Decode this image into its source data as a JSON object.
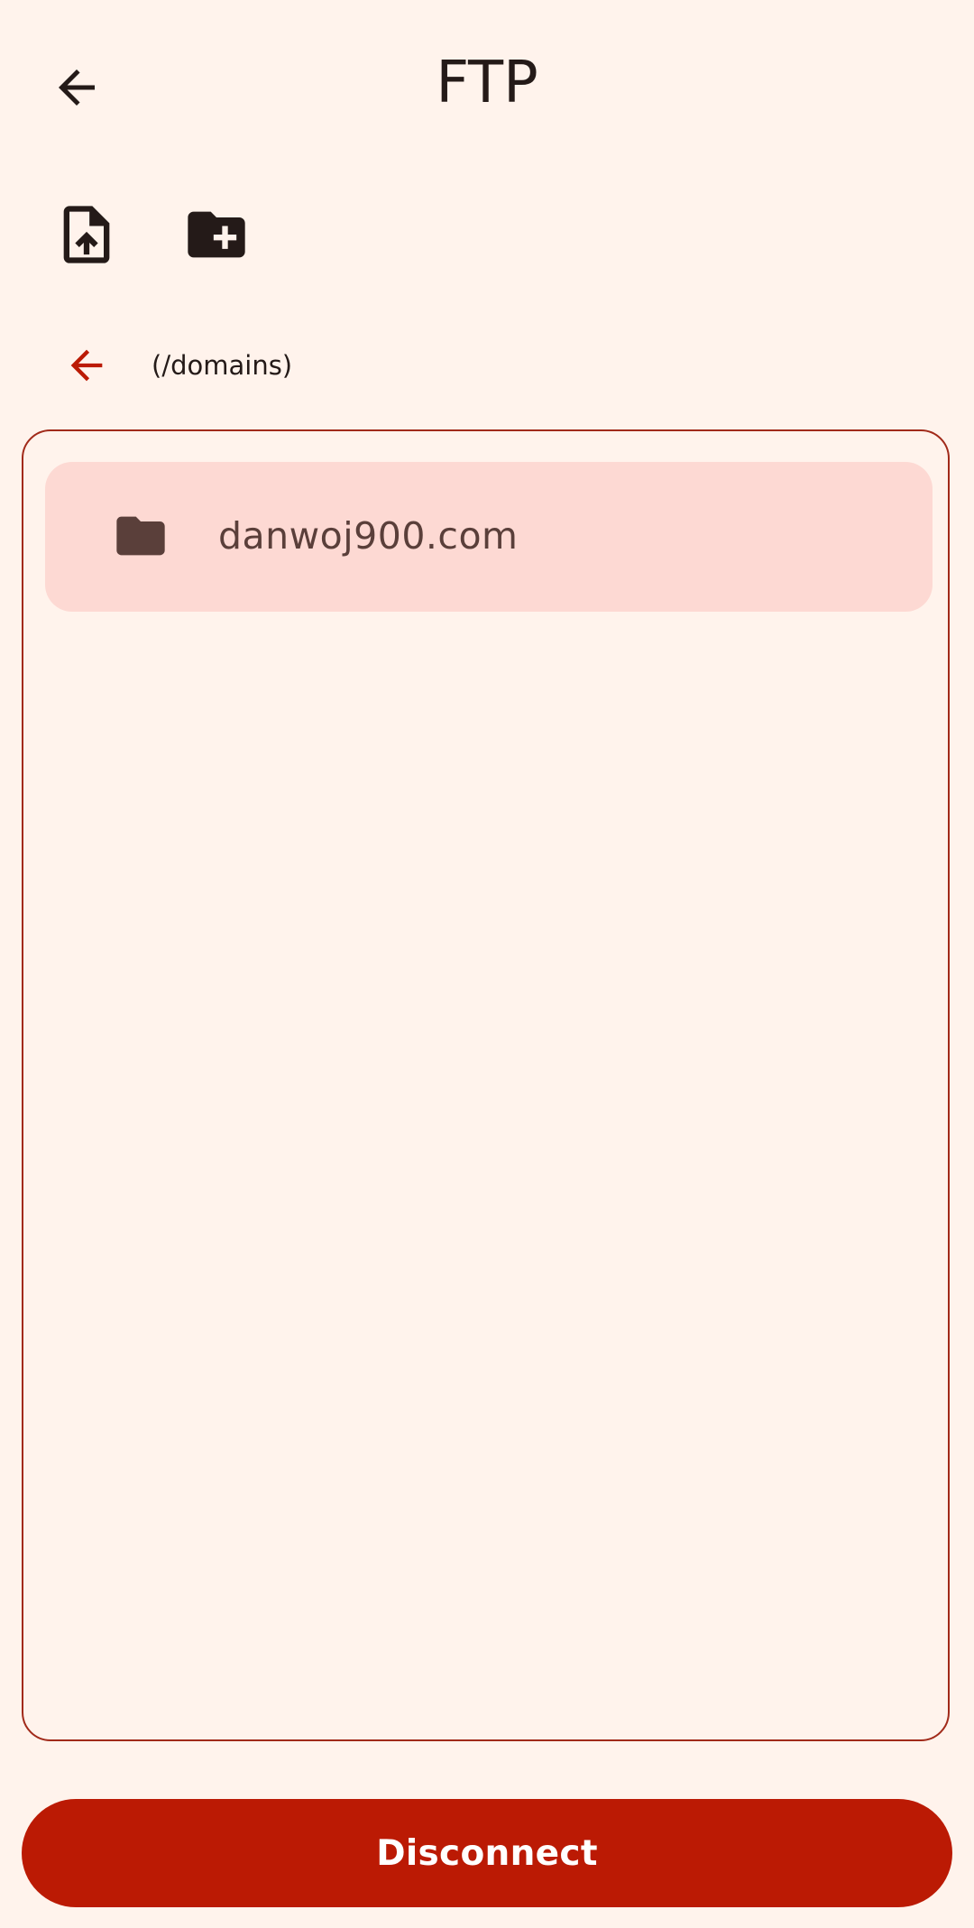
{
  "header": {
    "title": "FTP",
    "back_icon": "arrow-back-icon"
  },
  "toolbar": {
    "upload_icon": "file-upload-icon",
    "new_folder_icon": "create-new-folder-icon"
  },
  "path": {
    "up_icon": "arrow-back-icon",
    "current": "(/domains)"
  },
  "files": [
    {
      "name": "danwoj900.com",
      "type": "folder",
      "icon": "folder-icon"
    }
  ],
  "actions": {
    "disconnect_label": "Disconnect"
  },
  "colors": {
    "background": "#FFF3EC",
    "accent": "#BB1A04",
    "panel_border": "#A12A1A",
    "item_bg": "#FDD9D3",
    "icon_dark": "#241A18",
    "item_text": "#5A3F3A"
  }
}
